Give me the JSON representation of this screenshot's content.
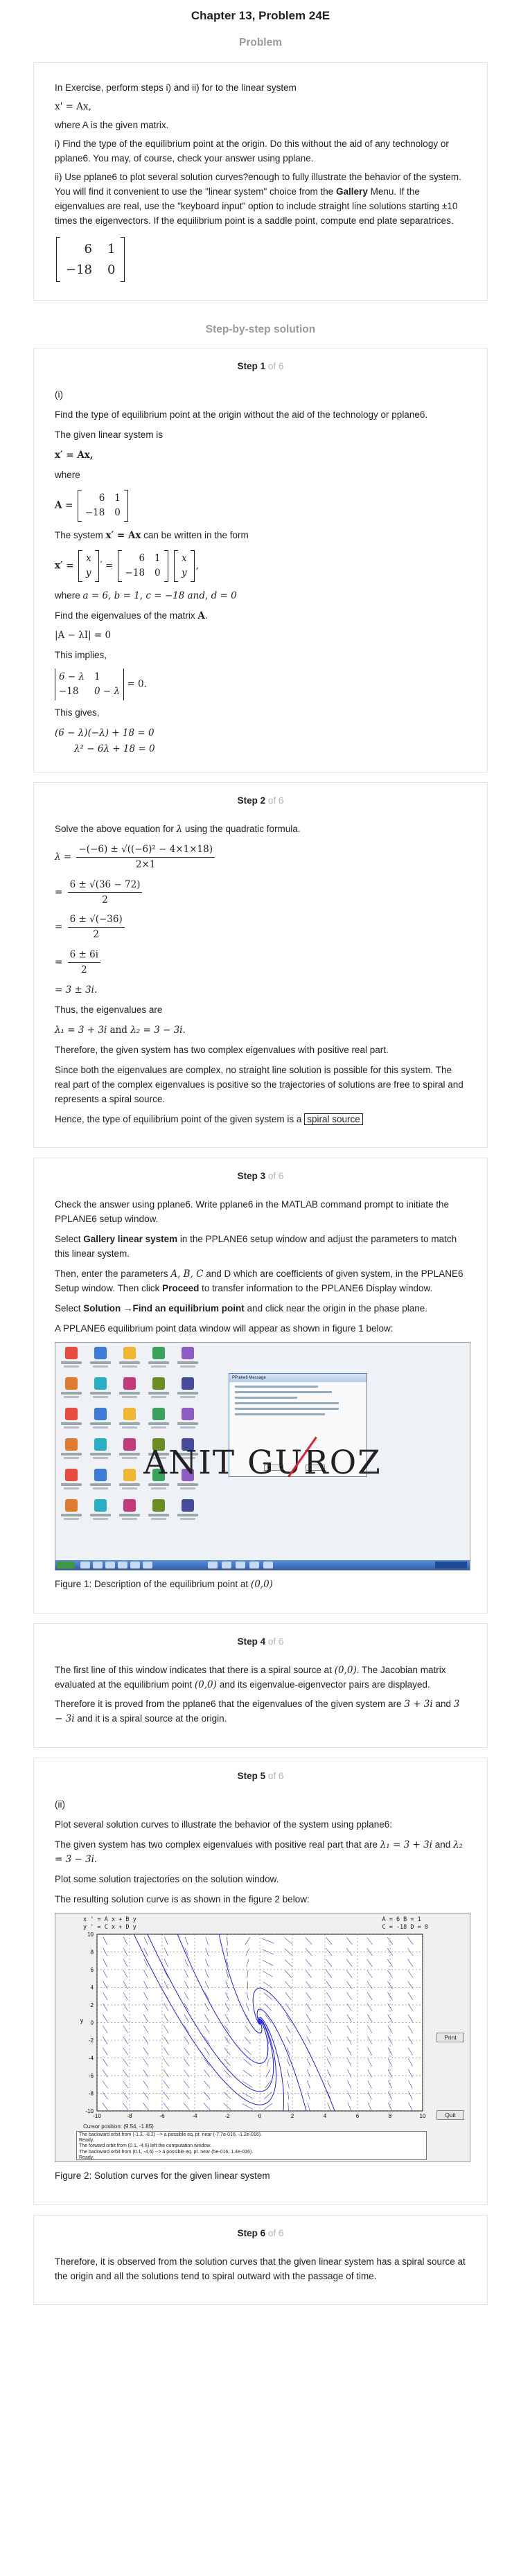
{
  "header": {
    "title": "Chapter 13, Problem 24E",
    "problem_label": "Problem"
  },
  "problem": {
    "intro": "In Exercise, perform steps i) and ii) for to the linear system",
    "system": "x' = Ax,",
    "where": "where A is the given matrix.",
    "part_i": "i) Find the type of the equilibrium point at the origin. Do this without the aid of any technology or pplane6. You may, of course, check your answer using pplane.",
    "part_ii_1": "ii) Use pplane6 to plot several solution curves?enough to fully illustrate the behavior of the system. You will find it convenient to use the \"linear system\" choice from the ",
    "part_ii_bold": "Gallery",
    "part_ii_2": " Menu. If the eigenvalues are real, use the \"keyboard input\" option to include straight line solutions starting ±10 times the eigenvectors. If the equilibrium point is a saddle point, compute end plate separatrices.",
    "matrix": [
      "6",
      "1",
      "−18",
      "0"
    ]
  },
  "solution_heading": "Step-by-step solution",
  "step_word": "Step",
  "of_text": "of 6",
  "steps": {
    "s1": {
      "number": "1",
      "part": "(i)",
      "p1": "Find the type of equilibrium point at the origin without the aid of the technology or pplane6.",
      "p2": "The given linear system is",
      "eq1": "x′ = Ax,",
      "where": "where",
      "A_label": "A =",
      "matrix": [
        "6",
        "1",
        "−18",
        "0"
      ],
      "p3a": "The system",
      "p3m": "x′ = Ax",
      "p3b": "can be written in the form",
      "vec_lhs_label": "x′ =",
      "vec_top": "x",
      "vec_bot": "y",
      "vec_prime": "′",
      "eq_sign": "=",
      "where2": "where",
      "params": "a = 6, b = 1, c = −18 and, d = 0",
      "p4": "Find the eigenvalues of the matrix",
      "p4m": "A",
      "p4end": ".",
      "det_eq": "|A − λI| = 0",
      "p5": "This implies,",
      "det2": [
        "6 − λ",
        "1",
        "−18",
        "0 − λ"
      ],
      "det2_rhs": "= 0.",
      "p6": "This gives,",
      "g1": "(6 − λ)(−λ) + 18 = 0",
      "g2": "λ² − 6λ + 18 = 0"
    },
    "s2": {
      "number": "2",
      "p1a": "Solve the above equation for",
      "p1m": "λ",
      "p1b": "using the quadratic formula.",
      "q1_lhs": "λ =",
      "q1_num": "−(−6) ± √((−6)² − 4×1×18)",
      "q1_den": "2×1",
      "q2_num": "6 ± √(36 − 72)",
      "q2_den": "2",
      "q3_num": "6 ± √(−36)",
      "q3_den": "2",
      "q4_num": "6 ± 6i",
      "q4_den": "2",
      "q5": "= 3 ± 3i.",
      "eq_sign": "=",
      "p2": "Thus, the eigenvalues are",
      "ev1": "λ₁ = 3 + 3i",
      "and": "and",
      "ev2": "λ₂ = 3 − 3i.",
      "p3": "Therefore, the given system has two complex eigenvalues with positive real part.",
      "p4": "Since both the eigenvalues are complex, no straight line solution is possible for this system. The real part of the complex eigenvalues is positive so the trajectories of solutions are free to spiral and represents a spiral source.",
      "p5": "Hence, the type of equilibrium point of the given system is a",
      "boxed": "spiral source"
    },
    "s3": {
      "number": "3",
      "p1": "Check the answer using pplane6. Write pplane6 in the MATLAB command prompt to initiate the PPLANE6 setup window.",
      "p2a": "Select ",
      "p2b": "Gallery linear system",
      "p2c": " in the PPLANE6 setup window and adjust the parameters to match this linear system.",
      "p3a": "Then, enter the parameters ",
      "p3m": "A, B, C",
      "p3b": " and D which are coefficients of given system, in the PPLANE6 Setup window. Then click ",
      "p3c": "Proceed",
      "p3d": " to transfer information to the PPLANE6 Display window.",
      "p4a": "Select ",
      "p4b": "Solution",
      "p4c": " →",
      "p4d": "Find an equilibrium point",
      "p4e": " and click near the origin in the phase plane.",
      "p5": "A PPLANE6 equilibrium point data window will appear as shown in figure 1 below:",
      "watermark": "ANIT GUROZ",
      "popup_title": "PPlane6 Message",
      "caption_a": "Figure 1: Description of the equilibrium point at",
      "caption_m": "(0,0)"
    },
    "s4": {
      "number": "4",
      "p1a": "The first line of this window indicates that there is a spiral source at",
      "p1m": "(0,0)",
      "p1b": ". The Jacobian matrix evaluated at the equilibrium point",
      "p1m2": "(0,0)",
      "p1c": "and its eigenvalue-eigenvector pairs are displayed.",
      "p2a": "Therefore it is proved from the pplane6 that the eigenvalues of the given system are",
      "p2m1": "3 + 3i",
      "p2b": "and",
      "p2m2": "3 − 3i",
      "p2c": "and it is a spiral source at the origin."
    },
    "s5": {
      "number": "5",
      "part": "(ii)",
      "p1": "Plot several solution curves to illustrate the behavior of the system using pplane6:",
      "p2a": "The given system has two complex eigenvalues with positive real part that are",
      "p2m1": "λ₁ = 3 + 3i",
      "p2b": "and",
      "p2m2": "λ₂ = 3 − 3i.",
      "p3": "Plot some solution trajectories on the solution window.",
      "p4": "The resulting solution curve is as shown in the figure 2 below:",
      "plot_eq1": "x ' = A x + B y",
      "plot_eq2": "y ' = C x + D y",
      "plot_params1": "A = 6        B = 1",
      "plot_params2": "C = -18      D = 0",
      "xlabel": "x",
      "ylabel": "y",
      "print_btn": "Print",
      "quit_btn": "Quit",
      "cursor": "Cursor position:  (9.54, -1.85)",
      "msg1": "The backward orbit from (-1.3, -8.2) --> a possible eq. pt. near (-7.7e-016, -1.2e-016).",
      "msg2": "Ready.",
      "msg3": "The forward orbit from (0.1, -4.6) left the computation window.",
      "msg4": "The backward orbit from (0.1, -4.6) --> a possible eq. pt. near (5e-016, 1.4e-016).",
      "msg5": "Ready.",
      "caption": "Figure 2: Solution curves for the given linear system"
    },
    "s6": {
      "number": "6",
      "p1": "Therefore, it is observed from the solution curves that the given linear system has a spiral source at the origin and all the solutions tend to spiral outward with the passage of time."
    }
  },
  "chart_data": {
    "type": "line",
    "title": "",
    "xlabel": "x",
    "ylabel": "y",
    "xlim": [
      -10,
      10
    ],
    "ylim": [
      -10,
      10
    ],
    "xticks": [
      -10,
      -8,
      -6,
      -4,
      -2,
      0,
      2,
      4,
      6,
      8,
      10
    ],
    "yticks": [
      -10,
      -8,
      -6,
      -4,
      -2,
      0,
      2,
      4,
      6,
      8,
      10
    ],
    "grid": true,
    "direction_field": true,
    "system": {
      "A": 6,
      "B": 1,
      "C": -18,
      "D": 0
    },
    "trajectory_starts": [
      [
        -1.3,
        -8.2
      ],
      [
        0.1,
        -4.6
      ],
      [
        0.3,
        1.2
      ],
      [
        -0.4,
        3.0
      ],
      [
        0.6,
        -2.0
      ],
      [
        -0.2,
        -1.0
      ],
      [
        0.15,
        0.4
      ]
    ],
    "colors": {
      "trajectory": "#1f1fe6",
      "field": "#3a3aaa",
      "grid": "#555555"
    }
  }
}
